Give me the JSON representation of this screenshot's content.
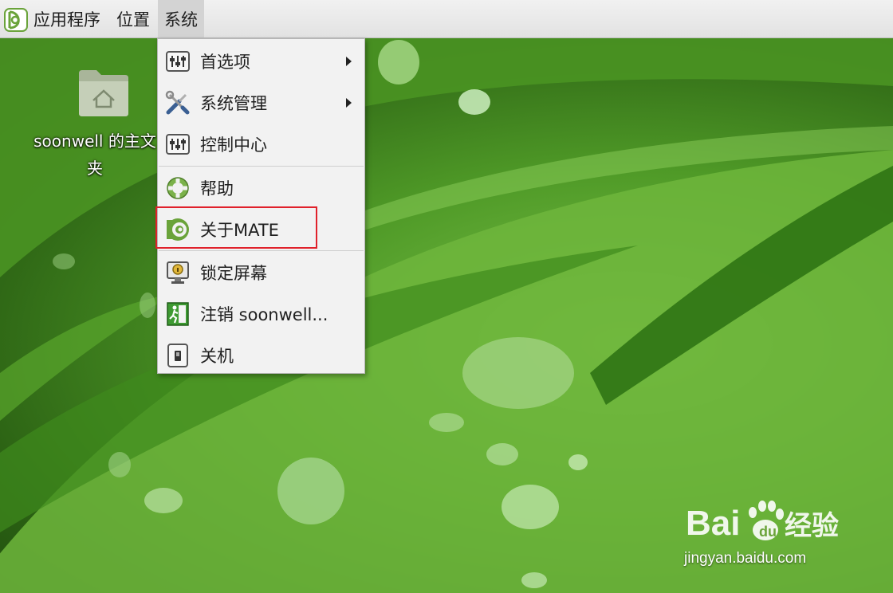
{
  "top_panel": {
    "logo_icon": "mate-logo-icon",
    "menus": [
      {
        "label": "应用程序"
      },
      {
        "label": "位置"
      },
      {
        "label": "系统"
      }
    ],
    "active_menu": "系统"
  },
  "desktop": {
    "home_folder": {
      "icon": "home-folder-icon",
      "label": "soonwell 的主文夹"
    }
  },
  "system_menu": {
    "items": [
      {
        "label": "首选项",
        "icon": "preferences-icon",
        "has_submenu": true
      },
      {
        "label": "系统管理",
        "icon": "tools-icon",
        "has_submenu": true
      },
      {
        "label": "控制中心",
        "icon": "control-center-icon",
        "has_submenu": false
      },
      {
        "label": "帮助",
        "icon": "help-lifebuoy-icon",
        "has_submenu": false
      },
      {
        "label": "关于MATE",
        "icon": "mate-logo-icon",
        "has_submenu": false,
        "highlighted": true
      },
      {
        "label": "锁定屏幕",
        "icon": "lock-screen-icon",
        "has_submenu": false
      },
      {
        "label": "注销 soonwell...",
        "icon": "logout-icon",
        "has_submenu": false
      },
      {
        "label": "关机",
        "icon": "shutdown-icon",
        "has_submenu": false
      }
    ]
  },
  "annotation": {
    "color": "#e0212b"
  },
  "watermark": {
    "brand": "Bai du 经验",
    "url": "jingyan.baidu.com"
  },
  "colors": {
    "panel_bg": "#e9e9e9",
    "menu_bg": "#f2f2f2",
    "mate_green": "#6aa33a"
  }
}
